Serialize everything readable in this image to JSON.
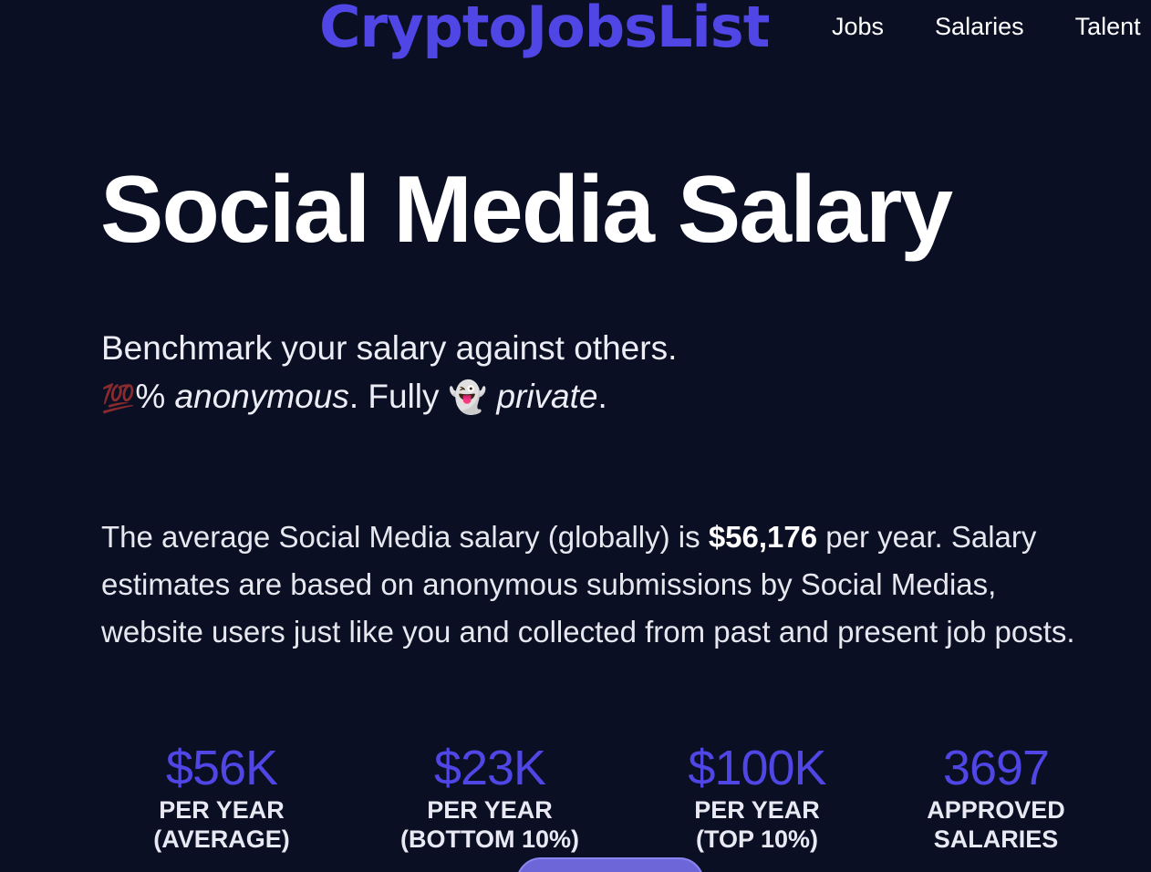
{
  "header": {
    "logo": "CryptoJobsList",
    "nav": {
      "jobs": "Jobs",
      "salaries": "Salaries",
      "talent": "Talent"
    }
  },
  "hero": {
    "title": "Social Media Salary",
    "tagline_line1": "Benchmark your salary against others.",
    "tagline_emoji_100": "💯",
    "tagline_pct": "% ",
    "tagline_anonymous": "anonymous",
    "tagline_fully": ". Fully ",
    "tagline_emoji_ghost": "👻",
    "tagline_private": "private",
    "tagline_end": "."
  },
  "description": {
    "prefix": "The average Social Media salary (globally) is ",
    "amount": "$56,176",
    "suffix": " per year. Salary estimates are based on anonymous submissions by Social Medias, website users just like you and collected from past and present job posts."
  },
  "stats": [
    {
      "value": "$56K",
      "label_line1": "PER YEAR",
      "label_line2": "(AVERAGE)"
    },
    {
      "value": "$23K",
      "label_line1": "PER YEAR",
      "label_line2": "(BOTTOM 10%)"
    },
    {
      "value": "$100K",
      "label_line1": "PER YEAR",
      "label_line2": "(TOP 10%)"
    },
    {
      "value": "3697",
      "label_line1": "APPROVED",
      "label_line2": "SALARIES"
    }
  ],
  "colors": {
    "background": "#0b0f24",
    "accent": "#4f46e5",
    "text": "#ffffff"
  }
}
